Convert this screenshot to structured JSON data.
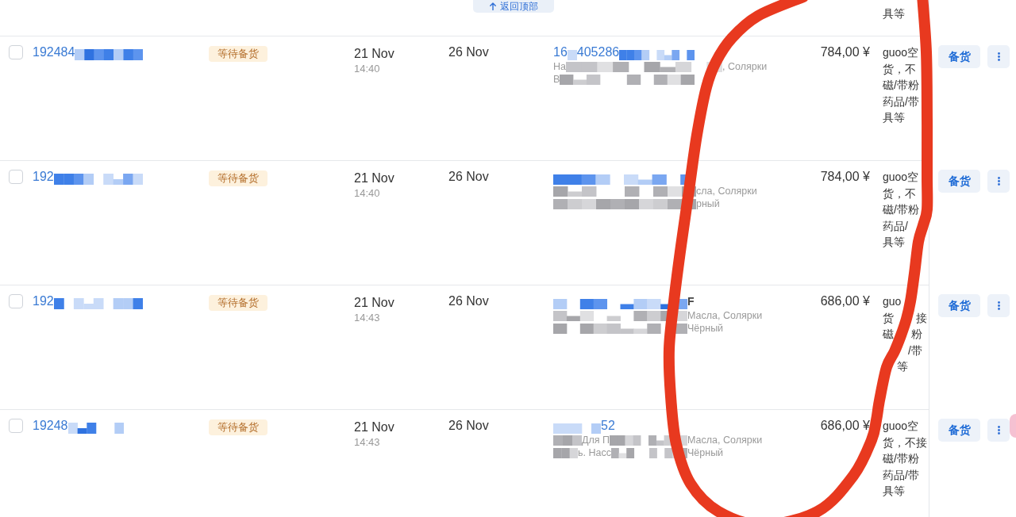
{
  "back_to_top": {
    "label": "返回顶部"
  },
  "previous_order": {
    "note_tail": "具等"
  },
  "orders": [
    {
      "checked": false,
      "order_no": "192484",
      "status": "等待备货",
      "created_date": "21 Nov",
      "created_time": "14:40",
      "ship_by": "26 Nov",
      "product_lines": [
        {
          "parts": [
            {
              "kind": "link",
              "text": "16"
            },
            {
              "kind": "redacted"
            },
            {
              "kind": "link",
              "text": "405286"
            },
            {
              "kind": "redacted"
            }
          ]
        },
        {
          "parts": [
            {
              "kind": "text",
              "text": "На"
            },
            {
              "kind": "redacted"
            }
          ],
          "tail": {
            "kind": "text",
            "text": ", Солярки"
          }
        },
        {
          "parts": [
            {
              "kind": "text",
              "text": "В"
            },
            {
              "kind": "redacted"
            }
          ]
        }
      ],
      "price": "784,00 ¥",
      "note_lines": [
        {
          "left": "guoo空"
        },
        {
          "left": "货，不"
        },
        {
          "left": "磁/带粉"
        },
        {
          "left": "药品/带"
        },
        {
          "left": "具等"
        }
      ],
      "action": "备货"
    },
    {
      "checked": false,
      "order_no": "192",
      "status": "等待备货",
      "created_date": "21 Nov",
      "created_time": "14:40",
      "ship_by": "26 Nov",
      "product_lines": [
        {
          "parts": [
            {
              "kind": "redacted"
            }
          ]
        },
        {
          "parts": [
            {
              "kind": "redacted"
            }
          ],
          "tail": {
            "kind": "text",
            "text": "сла, Солярки"
          }
        },
        {
          "parts": [
            {
              "kind": "redacted"
            }
          ],
          "tail": {
            "kind": "text",
            "text": "рный"
          }
        }
      ],
      "price": "784,00 ¥",
      "note_lines": [
        {
          "left": "guoo空"
        },
        {
          "left": "货，不"
        },
        {
          "left": "磁/带粉"
        },
        {
          "left": "药品/"
        },
        {
          "left": "具等"
        }
      ],
      "action": "备货"
    },
    {
      "checked": false,
      "order_no": "192",
      "status": "等待备货",
      "created_date": "21 Nov",
      "created_time": "14:43",
      "ship_by": "26 Nov",
      "product_lines": [
        {
          "parts": [
            {
              "kind": "redacted"
            }
          ],
          "tail": {
            "kind": "title",
            "text": "F"
          }
        },
        {
          "parts": [
            {
              "kind": "redacted"
            }
          ],
          "tail": {
            "kind": "text",
            "text": "Масла, Солярки"
          }
        },
        {
          "parts": [
            {
              "kind": "redacted"
            }
          ],
          "tail": {
            "kind": "text",
            "text": "Чёрный"
          }
        }
      ],
      "price": "686,00 ¥",
      "note_lines": [
        {
          "left": "guo"
        },
        {
          "left": "货",
          "right": "接"
        },
        {
          "left": "磁",
          "right": "粉"
        },
        {
          "right": "/带"
        },
        {
          "right": "等"
        }
      ],
      "action": "备货"
    },
    {
      "checked": false,
      "order_no": "19248",
      "status": "等待备货",
      "created_date": "21 Nov",
      "created_time": "14:43",
      "ship_by": "26 Nov",
      "product_lines": [
        {
          "parts": [
            {
              "kind": "redacted"
            },
            {
              "kind": "link",
              "text": "52"
            }
          ]
        },
        {
          "parts": [
            {
              "kind": "redacted"
            },
            {
              "kind": "text",
              "text": "Для П"
            },
            {
              "kind": "redacted"
            }
          ],
          "tail": {
            "kind": "text",
            "text": "Масла, Солярки"
          }
        },
        {
          "parts": [
            {
              "kind": "redacted"
            },
            {
              "kind": "text",
              "text": "ь. Насс"
            },
            {
              "kind": "redacted"
            }
          ],
          "tail": {
            "kind": "text",
            "text": "Чёрный"
          }
        }
      ],
      "price": "686,00 ¥",
      "note_lines": [
        {
          "left": "guoo空"
        },
        {
          "left": "货，不接"
        },
        {
          "left": "磁/带粉"
        },
        {
          "left": "药品/带"
        },
        {
          "left": "具等"
        }
      ],
      "action": "备货"
    }
  ]
}
